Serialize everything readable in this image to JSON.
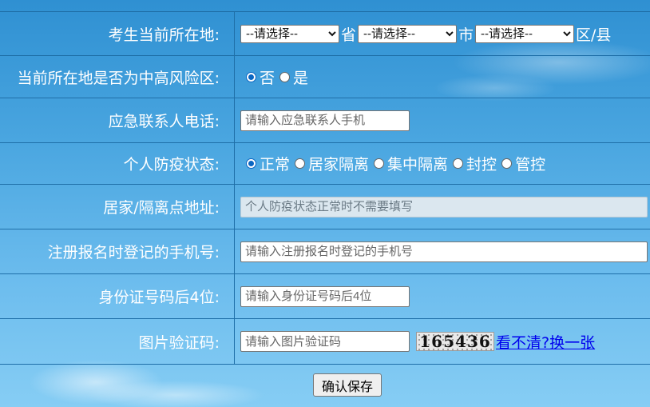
{
  "form": {
    "location": {
      "label": "考生当前所在地:",
      "province_select": "--请选择--",
      "province_unit": "省",
      "city_select": "--请选择--",
      "city_unit": "市",
      "district_select": "--请选择--",
      "district_unit": "区/县"
    },
    "risk_area": {
      "label": "当前所在地是否为中高风险区:",
      "options": [
        "否",
        "是"
      ],
      "selected": "否"
    },
    "emergency_phone": {
      "label": "应急联系人电话:",
      "placeholder": "请输入应急联系人手机"
    },
    "epidemic_status": {
      "label": "个人防疫状态:",
      "options": [
        "正常",
        "居家隔离",
        "集中隔离",
        "封控",
        "管控"
      ],
      "selected": "正常"
    },
    "quarantine_address": {
      "label": "居家/隔离点地址:",
      "placeholder": "个人防疫状态正常时不需要填写"
    },
    "registered_phone": {
      "label": "注册报名时登记的手机号:",
      "placeholder": "请输入注册报名时登记的手机号"
    },
    "id_last4": {
      "label": "身份证号码后4位:",
      "placeholder": "请输入身份证号码后4位"
    },
    "captcha": {
      "label": "图片验证码:",
      "placeholder": "请输入图片验证码",
      "image_text": "165436",
      "refresh_link": "看不清?换一张"
    }
  },
  "footer": {
    "save_label": "确认保存"
  },
  "colors": {
    "background_top": "#2f90d2",
    "background_bottom": "#86cdf4",
    "grid_line": "#1f6fa8",
    "link": "#0000ee",
    "radio_selected": "#0a66c2"
  }
}
